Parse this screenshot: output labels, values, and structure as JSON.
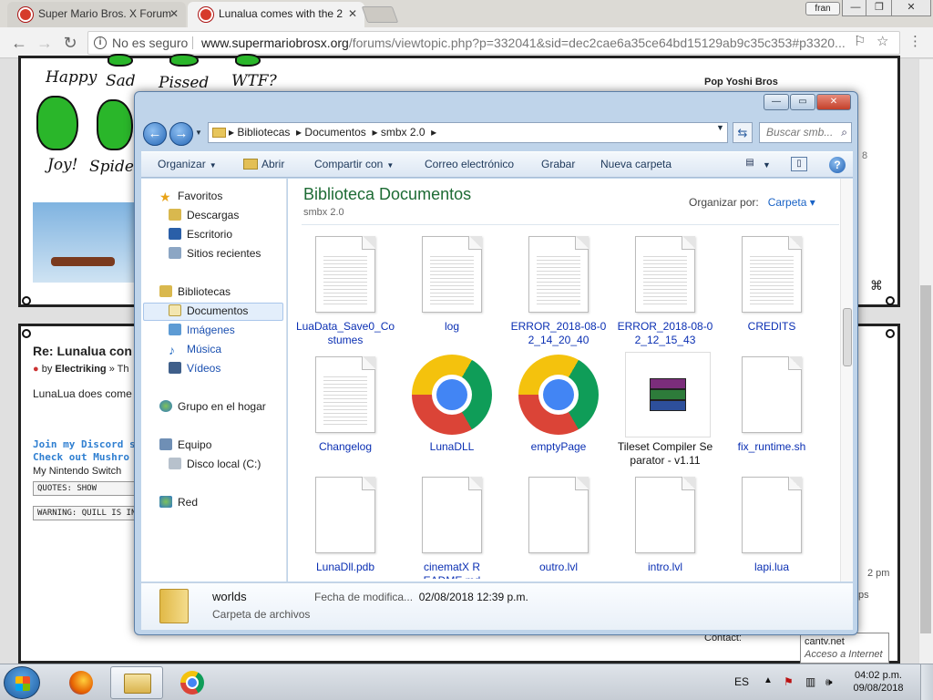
{
  "browser": {
    "tabs": [
      {
        "label": "Super Mario Bros. X Forum"
      },
      {
        "label": "Lunalua comes with the 2"
      }
    ],
    "user": "fran",
    "security_label": "No es seguro",
    "url_domain": "www.supermariobrosx.org",
    "url_path": "/forums/viewtopic.php?p=332041&sid=dec2cae6a35ce64bd15129ab9c35c353#p3320..."
  },
  "page": {
    "yoshi_labels": [
      "Happy",
      "Sad",
      "Pissed",
      "WTF?",
      "Joy!",
      "Spider-"
    ],
    "right_user": "Pop Yoshi Bros",
    "post_title": "Re: Lunalua con",
    "post_by": "by",
    "post_author": "Electriking",
    "post_author_suffix": "» Th",
    "post_text": "LunaLua does come",
    "sig_line1": "Join my Discord s",
    "sig_line2": "Check out Mushro",
    "sig_line3": "My Nintendo Switch",
    "quotes_box": "QUOTES: SHOW",
    "warning_box": "WARNING: QUILL IS IN",
    "side_fragment_1": "8",
    "side_fragment_2": "2 pm",
    "side_fragment_3": "ps",
    "contact_label": "Contact:",
    "tooltip_line1": "cantv.net",
    "tooltip_line2": "Acceso a Internet"
  },
  "explorer": {
    "breadcrumbs": [
      "Bibliotecas",
      "Documentos",
      "smbx 2.0"
    ],
    "search_placeholder": "Buscar smb...",
    "toolbar": {
      "organize": "Organizar",
      "open": "Abrir",
      "share": "Compartir con",
      "email": "Correo electrónico",
      "burn": "Grabar",
      "new_folder": "Nueva carpeta"
    },
    "nav": {
      "favorites": "Favoritos",
      "downloads": "Descargas",
      "desktop": "Escritorio",
      "recent": "Sitios recientes",
      "libraries": "Bibliotecas",
      "documents": "Documentos",
      "pictures": "Imágenes",
      "music": "Música",
      "videos": "Vídeos",
      "homegroup": "Grupo en el hogar",
      "computer": "Equipo",
      "local_disk": "Disco local (C:)",
      "network": "Red"
    },
    "library_title": "Biblioteca Documentos",
    "library_subtitle": "smbx 2.0",
    "arrange_by_label": "Organizar por:",
    "arrange_by_value": "Carpeta",
    "files": [
      {
        "name": "LuaData_Save0_Costumes",
        "icon": "text-document-icon"
      },
      {
        "name": "log",
        "icon": "text-document-icon"
      },
      {
        "name": "ERROR_2018-08-02_14_20_40",
        "icon": "text-document-icon"
      },
      {
        "name": "ERROR_2018-08-02_12_15_43",
        "icon": "text-document-icon"
      },
      {
        "name": "CREDITS",
        "icon": "text-document-icon"
      },
      {
        "name": "Changelog",
        "icon": "text-document-icon"
      },
      {
        "name": "LunaDLL",
        "icon": "chrome-icon"
      },
      {
        "name": "emptyPage",
        "icon": "chrome-icon"
      },
      {
        "name": "Tileset Compiler Separator - v1.11",
        "icon": "winrar-icon"
      },
      {
        "name": "fix_runtime.sh",
        "icon": "blank-document-icon"
      },
      {
        "name": "LunaDll.pdb",
        "icon": "blank-document-icon"
      },
      {
        "name": "cinematX README.md",
        "icon": "blank-document-icon"
      },
      {
        "name": "outro.lvl",
        "icon": "blank-document-icon"
      },
      {
        "name": "intro.lvl",
        "icon": "blank-document-icon"
      },
      {
        "name": "lapi.lua",
        "icon": "blank-document-icon"
      }
    ],
    "details": {
      "name": "worlds",
      "type": "Carpeta de archivos",
      "date_label": "Fecha de modifica...",
      "date_value": "02/08/2018 12:39 p.m."
    }
  },
  "taskbar": {
    "language": "ES",
    "time": "04:02 p.m.",
    "date": "09/08/2018"
  }
}
